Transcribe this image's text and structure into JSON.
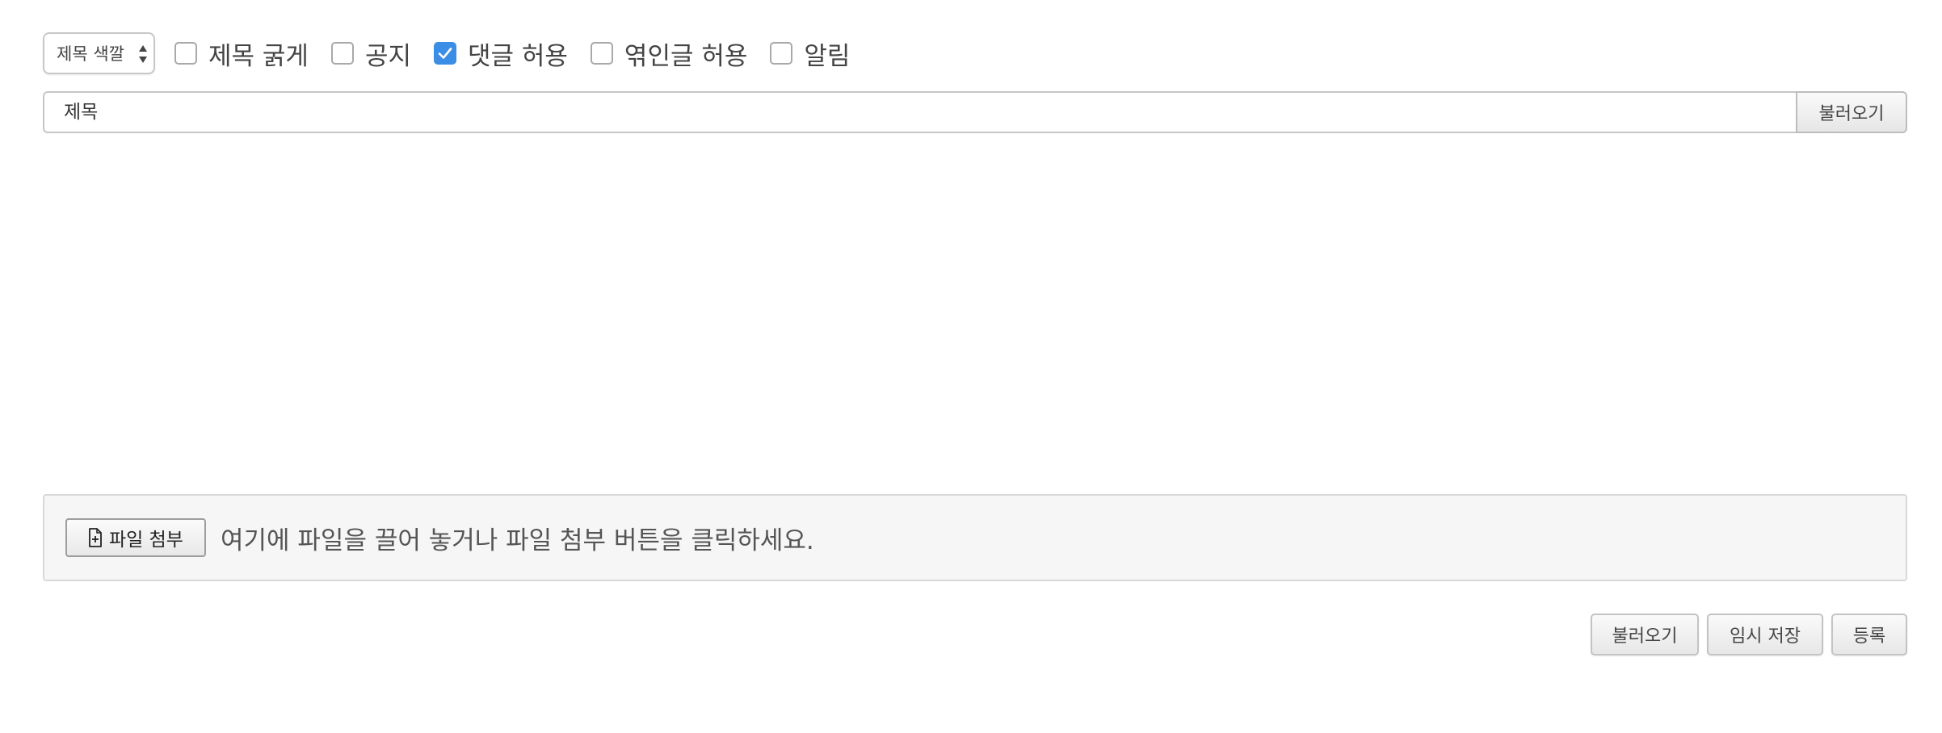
{
  "options": {
    "title_color_select": {
      "selected": "제목 색깔"
    },
    "checkboxes": [
      {
        "label": "제목 굵게",
        "checked": false
      },
      {
        "label": "공지",
        "checked": false
      },
      {
        "label": "댓글 허용",
        "checked": true
      },
      {
        "label": "엮인글 허용",
        "checked": false
      },
      {
        "label": "알림",
        "checked": false
      }
    ]
  },
  "title_row": {
    "title_placeholder": "제목",
    "title_value": "",
    "load_label": "불러오기"
  },
  "attachment": {
    "button_label": "파일 첨부",
    "hint": "여기에 파일을 끌어 놓거나 파일 첨부 버튼을 클릭하세요."
  },
  "actions": {
    "load_label": "불러오기",
    "draft_label": "임시 저장",
    "submit_label": "등록"
  },
  "colors": {
    "checkbox_checked": "#3a8ee6",
    "border": "#c6c6c6",
    "attach_background": "#f6f6f6"
  },
  "icons": {
    "select_arrows": "up-down-arrows-icon",
    "file_add": "file-plus-icon",
    "checkmark": "checkmark-icon"
  }
}
